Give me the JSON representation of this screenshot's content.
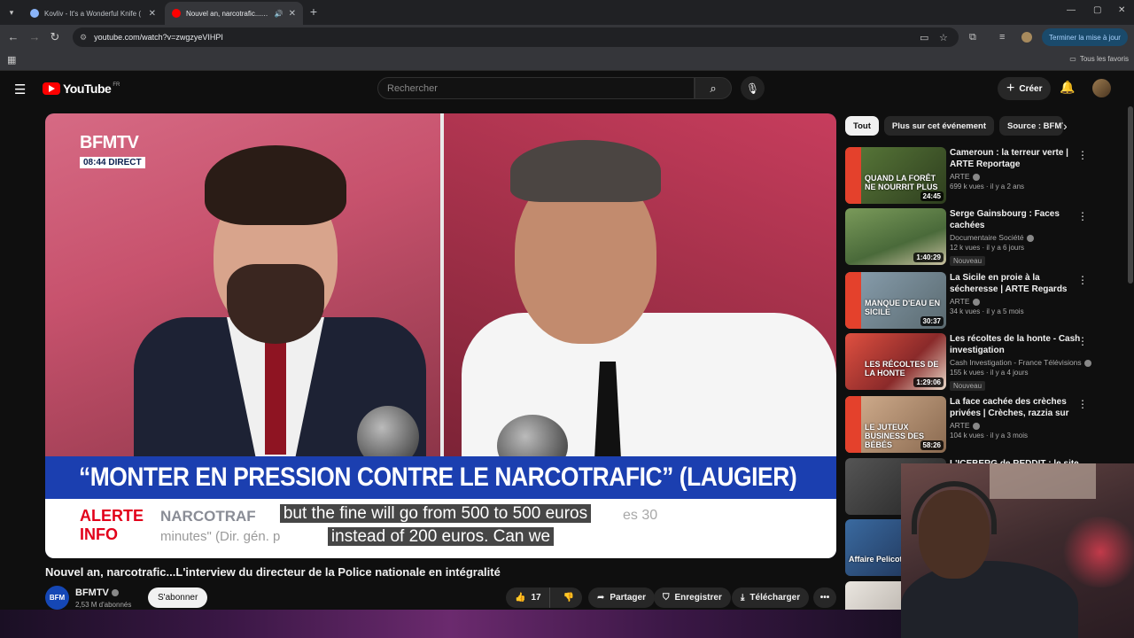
{
  "browser": {
    "tabs": [
      {
        "label": "Kovliv - It's a Wonderful Knife (",
        "fav_color": "#8ab4f8"
      },
      {
        "label": "Nouvel an, narcotrafic...L'inte",
        "fav_color": "#ff0000"
      }
    ],
    "new_tab": "+",
    "url": "youtube.com/watch?v=zwgzyeVIHPI",
    "update_button": "Terminer la mise à jour",
    "bookmarks_all": "Tous les favoris",
    "window": {
      "minimize": "—",
      "maximize": "▢",
      "close": "✕"
    }
  },
  "youtube": {
    "logo_word": "YouTube",
    "logo_country": "FR",
    "search_placeholder": "Rechercher",
    "create_label": "Créer"
  },
  "video": {
    "channel_logo": "BFMTV",
    "time_badge": "08:44  DIRECT",
    "banner": "“MONTER EN PRESSION CONTRE LE NARCOTRAFIC” (LAUGIER)",
    "alerte_line1": "ALERTE",
    "alerte_line2": "INFO",
    "ticker1": "NARCOTRAF",
    "ticker1_end": "es 30",
    "ticker2": "minutes\" (Dir. gén. p",
    "subtitle_line1": "but the fine will go from 500 to 500 euros",
    "subtitle_line2": "instead of 200 euros.  Can we",
    "title": "Nouvel an, narcotrafic...L'interview du directeur de la Police nationale en intégralité",
    "channel_name": "BFMTV",
    "channel_avatar": "BFM",
    "channel_subs": "2,53 M d'abonnés",
    "subscribe_label": "S'abonner",
    "like_count": "17",
    "share_label": "Partager",
    "save_label": "Enregistrer",
    "download_label": "Télécharger"
  },
  "chips": [
    {
      "label": "Tout",
      "active": true
    },
    {
      "label": "Plus sur cet événement",
      "active": false
    },
    {
      "label": "Source : BFMTV",
      "active": false
    }
  ],
  "recommendations": [
    {
      "title": "Cameroun : la terreur verte | ARTE Reportage",
      "channel": "ARTE",
      "stats": "699 k vues · il y a 2 ans",
      "duration": "24:45",
      "thumb_text": "Quand la forêt ne nourrit plus",
      "badge": "",
      "thumb_color": "#3e5a2a"
    },
    {
      "title": "Serge Gainsbourg : Faces cachées",
      "channel": "Documentaire Société",
      "stats": "12 k vues · il y a 6 jours",
      "duration": "1:40:29",
      "thumb_text": "",
      "badge": "Nouveau",
      "thumb_color": "#4f6b3a"
    },
    {
      "title": "La Sicile en proie à la sécheresse | ARTE Regards",
      "channel": "ARTE",
      "stats": "34 k vues · il y a 5 mois",
      "duration": "30:37",
      "thumb_text": "Manque d'eau en Sicile",
      "badge": "",
      "thumb_color": "#6a7a86"
    },
    {
      "title": "Les récoltes de la honte - Cash investigation",
      "channel": "Cash Investigation - France Télévisions",
      "stats": "155 k vues · il y a 4 jours",
      "duration": "1:29:06",
      "thumb_text": "Les récoltes de la honte",
      "badge": "Nouveau",
      "thumb_color": "#b04a3a"
    },
    {
      "title": "La face cachée des crèches privées | Crèches, razzia sur le...",
      "channel": "ARTE",
      "stats": "104 k vues · il y a 3 mois",
      "duration": "58:26",
      "thumb_text": "Le juteux business des bébés",
      "badge": "",
      "thumb_color": "#b68a66"
    }
  ],
  "partial_recs": [
    {
      "title": "L'ICEBERG de REDDIT : le site le...",
      "thumb_color": "#3a3a3a"
    },
    {
      "title": "",
      "thumb_color": "#2a4a7a",
      "thumb_text": "Affaire Pelicot"
    },
    {
      "title": "",
      "thumb_color": "#e3e0da"
    }
  ]
}
